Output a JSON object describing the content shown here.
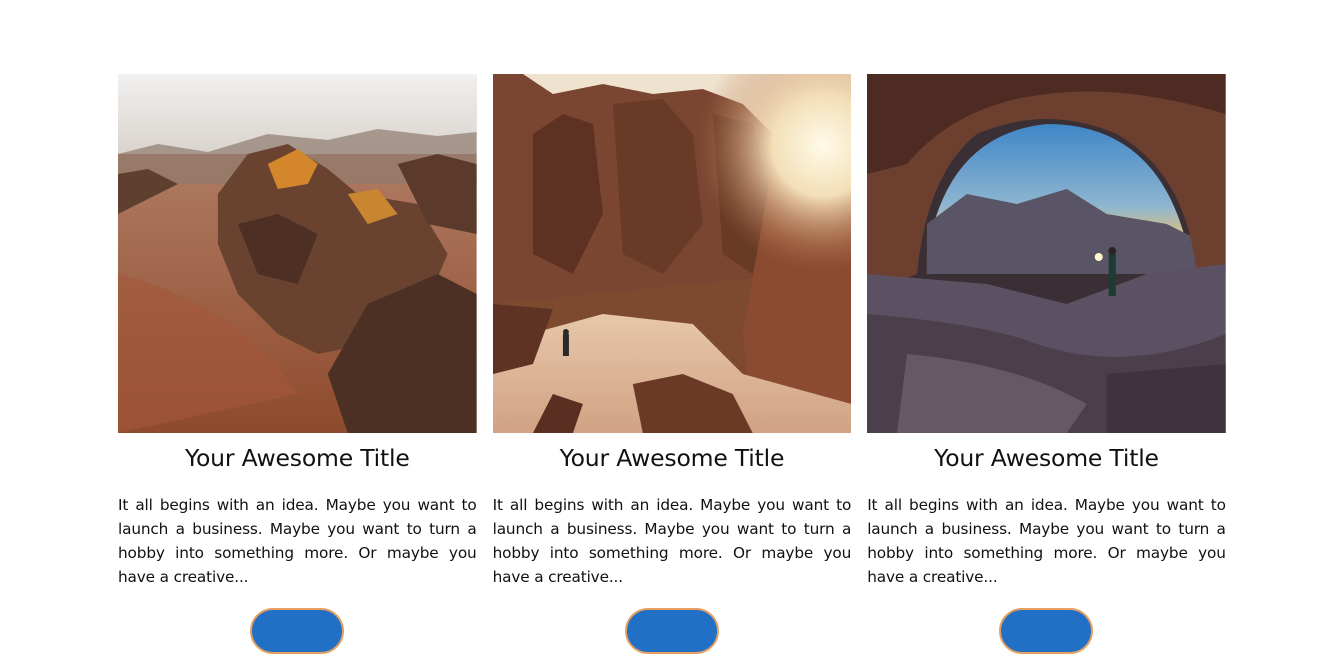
{
  "cards": [
    {
      "image_alt": "desert rock formations aerial view",
      "title": "Your Awesome Title",
      "excerpt": "It all begins with an idea. Maybe you want to launch a business. Maybe you want to turn a hobby into something more. Or maybe you have a creative...",
      "button_label": ""
    },
    {
      "image_alt": "canyon with hiker and sun flare",
      "title": "Your Awesome Title",
      "excerpt": "It all begins with an idea. Maybe you want to launch a business. Maybe you want to turn a hobby into something more. Or maybe you have a creative...",
      "button_label": ""
    },
    {
      "image_alt": "rock arch with person holding light at sunset",
      "title": "Your Awesome Title",
      "excerpt": "It all begins with an idea. Maybe you want to launch a business. Maybe you want to turn a hobby into something more. Or maybe you have a creative...",
      "button_label": ""
    }
  ],
  "colors": {
    "button_fill": "#2170c6",
    "button_border": "#e5a061",
    "text": "#111111"
  }
}
